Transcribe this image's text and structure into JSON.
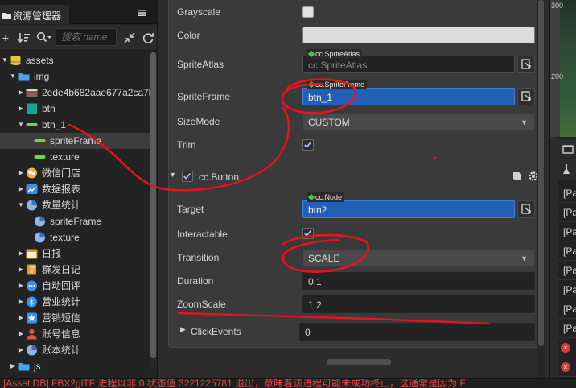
{
  "assets_panel": {
    "tab_title": "资源管理器",
    "search_placeholder": "搜索 name",
    "tree": [
      {
        "label": "assets",
        "icon": "database-icon",
        "arrow": "down"
      },
      {
        "label": "img",
        "icon": "folder-icon",
        "arrow": "down"
      },
      {
        "label": "2ede4b682aae677a2ca7b",
        "icon": "image-thumbnail-icon",
        "arrow": "right"
      },
      {
        "label": "btn",
        "icon": "texture-teal-icon",
        "arrow": "right"
      },
      {
        "label": "btn_1",
        "icon": "texture-green-icon",
        "arrow": "down"
      },
      {
        "label": "spriteFrame",
        "icon": "sprite-frame-icon",
        "arrow": "",
        "selected": true
      },
      {
        "label": "texture",
        "icon": "texture-green-icon",
        "arrow": ""
      },
      {
        "label": "微信门店",
        "icon": "wechat-icon",
        "arrow": "right"
      },
      {
        "label": "数据报表",
        "icon": "chart-icon",
        "arrow": "right"
      },
      {
        "label": "数量统计",
        "icon": "pie-icon",
        "arrow": "down"
      },
      {
        "label": "spriteFrame",
        "icon": "pie-icon",
        "arrow": ""
      },
      {
        "label": "texture",
        "icon": "pie-icon",
        "arrow": ""
      },
      {
        "label": "日报",
        "icon": "calendar-icon",
        "arrow": "right"
      },
      {
        "label": "群发日记",
        "icon": "notebook-icon",
        "arrow": "right"
      },
      {
        "label": "自动回评",
        "icon": "chat-icon",
        "arrow": "right"
      },
      {
        "label": "营业统计",
        "icon": "dollar-icon",
        "arrow": "right"
      },
      {
        "label": "营销短信",
        "icon": "star-badge-icon",
        "arrow": "right"
      },
      {
        "label": "账号信息",
        "icon": "user-icon",
        "arrow": "right"
      },
      {
        "label": "账本统计",
        "icon": "pie-icon",
        "arrow": "right"
      },
      {
        "label": "js",
        "icon": "folder-icon",
        "arrow": "right"
      }
    ]
  },
  "sprite_props": {
    "grayscale_label": "Grayscale",
    "color_label": "Color",
    "color_value": "#dcdcdc",
    "atlas_label": "SpriteAtlas",
    "atlas_tag": "cc.SpriteAtlas",
    "atlas_value": "cc.SpriteAtlas",
    "frame_label": "SpriteFrame",
    "frame_tag": "cc.SpriteFrame",
    "frame_value": "btn_1",
    "sizemode_label": "SizeMode",
    "sizemode_value": "CUSTOM",
    "trim_label": "Trim"
  },
  "button_component": {
    "title": "cc.Button",
    "target_label": "Target",
    "target_tag": "cc.Node",
    "target_value": "btn2",
    "interactable_label": "Interactable",
    "transition_label": "Transition",
    "transition_value": "SCALE",
    "duration_label": "Duration",
    "duration_value": "0.1",
    "zoomscale_label": "ZoomScale",
    "zoomscale_value": "1.2",
    "clickevents_label": "ClickEvents",
    "clickevents_value": "0"
  },
  "scene_view": {
    "ruler_ticks": [
      "300",
      "200"
    ]
  },
  "console": {
    "rows": [
      "[Pa",
      "[Pa",
      "[Pa",
      "[Pa",
      "[Pa",
      "[Pa",
      "[Pa",
      "[Pa"
    ]
  },
  "status_bar": {
    "message": "[Asset DB] FBX2glTF 进程以非 0 状态值 3221225781 退出，意味着该进程可能未成功终止，这通常是因为 F"
  },
  "colors": {
    "accent_blue": "#2260b6",
    "annotation_red": "#e8141c",
    "error_red": "#e04b4b"
  }
}
